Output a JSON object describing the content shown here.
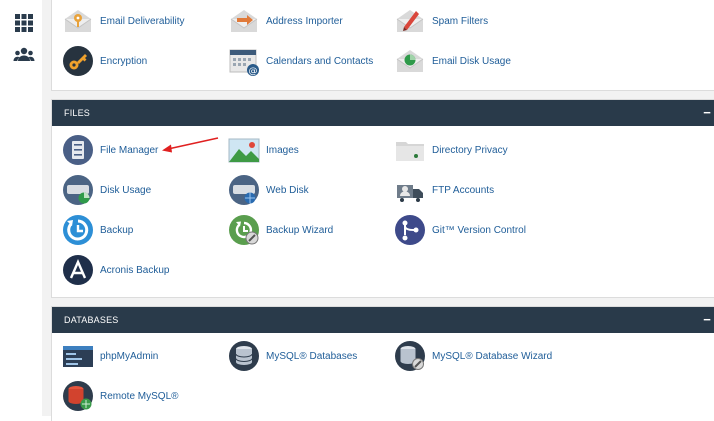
{
  "sidebar": [
    {
      "name": "grid-icon"
    },
    {
      "name": "users-icon"
    }
  ],
  "email_panel": {
    "items": [
      {
        "label": "Email Deliverability",
        "icon": "key-envelope-icon"
      },
      {
        "label": "Address Importer",
        "icon": "envelope-arrow-icon"
      },
      {
        "label": "Spam Filters",
        "icon": "pen-envelope-icon"
      },
      {
        "label": "Encryption",
        "icon": "encryption-key-icon"
      },
      {
        "label": "Calendars and Contacts",
        "icon": "calendar-at-icon"
      },
      {
        "label": "Email Disk Usage",
        "icon": "pie-envelope-icon"
      }
    ]
  },
  "files_panel": {
    "title": "FILES",
    "collapse_symbol": "−",
    "items": [
      {
        "label": "File Manager",
        "icon": "file-cabinet-icon"
      },
      {
        "label": "Images",
        "icon": "image-landscape-icon"
      },
      {
        "label": "Directory Privacy",
        "icon": "folder-icon"
      },
      {
        "label": "Disk Usage",
        "icon": "drive-pie-icon"
      },
      {
        "label": "Web Disk",
        "icon": "drive-globe-icon"
      },
      {
        "label": "FTP Accounts",
        "icon": "user-truck-icon"
      },
      {
        "label": "Backup",
        "icon": "backup-clock-icon"
      },
      {
        "label": "Backup Wizard",
        "icon": "backup-wizard-icon"
      },
      {
        "label": "Git™ Version Control",
        "icon": "git-branch-icon"
      },
      {
        "label": "Acronis Backup",
        "icon": "acronis-logo-icon"
      }
    ]
  },
  "databases_panel": {
    "title": "DATABASES",
    "collapse_symbol": "−",
    "items": [
      {
        "label": "phpMyAdmin",
        "icon": "phpmyadmin-window-icon"
      },
      {
        "label": "MySQL® Databases",
        "icon": "database-icon"
      },
      {
        "label": "MySQL® Database Wizard",
        "icon": "database-wizard-icon"
      },
      {
        "label": "Remote MySQL®",
        "icon": "remote-database-icon"
      }
    ]
  },
  "colors": {
    "panel_header": "#293a4a",
    "link": "#1f5d98",
    "background": "#f2f2f2",
    "annotation_arrow": "#e02020"
  }
}
